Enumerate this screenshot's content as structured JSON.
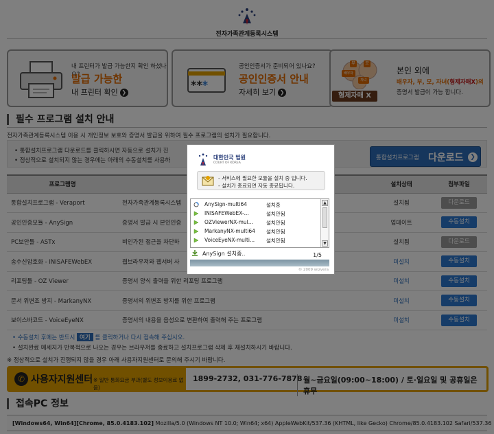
{
  "header": {
    "title": "전자가족관계등록시스템"
  },
  "cards": [
    {
      "small": "내 프린터가 발급 가능한지 확인 하셨나요?",
      "big": "발급 가능한",
      "sub": "내 프린터 확인"
    },
    {
      "small": "공인인증서가 준비되어 있나요?",
      "big": "공인인증서 안내",
      "sub": "자세히 보기",
      "mask": "**"
    },
    {
      "line1": "본인 외에",
      "line2_pre": "배우자, 부, 모, 자녀(",
      "line2_em": "형제자매X",
      "line2_post": ")의",
      "line3": "증명서 발급이 가능 합니다.",
      "badge": "형제자매 X",
      "fam1": "배우자",
      "fam2": "부",
      "fam3": "모",
      "fam4": "자녀"
    }
  ],
  "section_install": {
    "title": "필수 프로그램 설치 안내",
    "desc": "전자가족관계등록시스템 이용 시 개인정보 보호와 증명서 발급을 위하여 필수 프로그램의 설치가 필요합니다.",
    "notice1": "• 통합설치프로그램 다운로드를 클릭하시면 자동으로 설치가 진",
    "notice2": "• 정상적으로 설치되지 않는 경우에는 아래의 수동설치를 사용하",
    "download_small": "통합설치프로그램",
    "download_big": "다운로드"
  },
  "table": {
    "headers": [
      "프로그램명",
      "",
      "설치상태",
      "첨부파일"
    ],
    "rows": [
      {
        "name": "통합설치프로그램 - Veraport",
        "desc": "전자가족관계등록시스템",
        "status": "설치됨",
        "status_type": "gray",
        "button": "다운로드",
        "button_type": "gray"
      },
      {
        "name": "공인인증모듈 - AnySign",
        "desc": "증명서 발급 시 본인인증",
        "status": "업데이트",
        "status_type": "gray",
        "button": "수동설치",
        "button_type": "blue"
      },
      {
        "name": "PC보안툴 - ASTx",
        "desc": "비인가된 접근을 차단하",
        "status": "설치됨",
        "status_type": "gray",
        "button": "다운로드",
        "button_type": "gray"
      },
      {
        "name": "송수신암호화 - INISAFEWebEX",
        "desc": "웹브라우저와 웹서버 사",
        "status": "미설치",
        "status_type": "blue",
        "button": "수동설치",
        "button_type": "blue"
      },
      {
        "name": "리포팅툴 - OZ Viewer",
        "desc": "증명서 양식 출력을 위한 리포팅 프로그램",
        "status": "미설치",
        "status_type": "blue",
        "button": "수동설치",
        "button_type": "blue"
      },
      {
        "name": "문서 위변조 방지 - MarkanyNX",
        "desc": "증명서의 위변조 방지를 위한 프로그램",
        "status": "미설치",
        "status_type": "blue",
        "button": "수동설치",
        "button_type": "blue"
      },
      {
        "name": "보이스바코드 - VoiceEyeNX",
        "desc": "증명서의 내용을 음성으로 변환하여 출력해 주는 프로그램",
        "status": "미설치",
        "status_type": "blue",
        "button": "수동설치",
        "button_type": "blue"
      }
    ]
  },
  "footnotes": {
    "f1_pre": "• 수동설치 후에는 반드시",
    "f1_btn": "여기",
    "f1_post": "를 클릭하거나 다시 접속해 주십시오.",
    "f2": "• 설치완료 메세지가 반복적으로 나오는 경우는 브라우저를 종료하고 설치프로그램 삭제 후 재설치하시기 바랍니다.",
    "f3": "※ 정상적으로 설치가 진행되지 않을 경우 아래 사용자지원센터로 문의해 주시기 바랍니다."
  },
  "support": {
    "title": "사용자지원센터",
    "small": "※ 일반 통화요금 부과(별도 정보이용료 없음)",
    "phone": "1899-2732, 031-776-7878",
    "hours": "월~금요일(09:00~18:00) / 토·일요일 및 공휴일은 휴무"
  },
  "section_pc": {
    "title": "접속PC 정보",
    "ua_bold": "[Windows64, Win64][Chrome, 85.0.4183.102]",
    "ua": " Mozilla/5.0 (Windows NT 10.0; Win64; x64) AppleWebKit/537.36 (KHTML, like Gecko) Chrome/85.0.4183.102 Safari/537.36"
  },
  "modal": {
    "court": "대한민국 법원",
    "court_en": "COURT OF KOREA",
    "msg1": "- 서비스에 필요한 모듈을 설치 중 입니다.",
    "msg2": "- 설치가 종료되면 자동 종료됩니다.",
    "items": [
      {
        "name": "AnySign-multi64",
        "status": "설치중"
      },
      {
        "name": "INISAFEWebEX-...",
        "status": "설치안됨"
      },
      {
        "name": "OZViewerNX-mul...",
        "status": "설치안됨"
      },
      {
        "name": "MarkanyNX-multi64",
        "status": "설치안됨"
      },
      {
        "name": "VoiceEyeNX-multi...",
        "status": "설치안됨"
      }
    ],
    "current": "AnySign 설치중..",
    "count": "1/5",
    "copyright": "© 2009 wizvera"
  }
}
